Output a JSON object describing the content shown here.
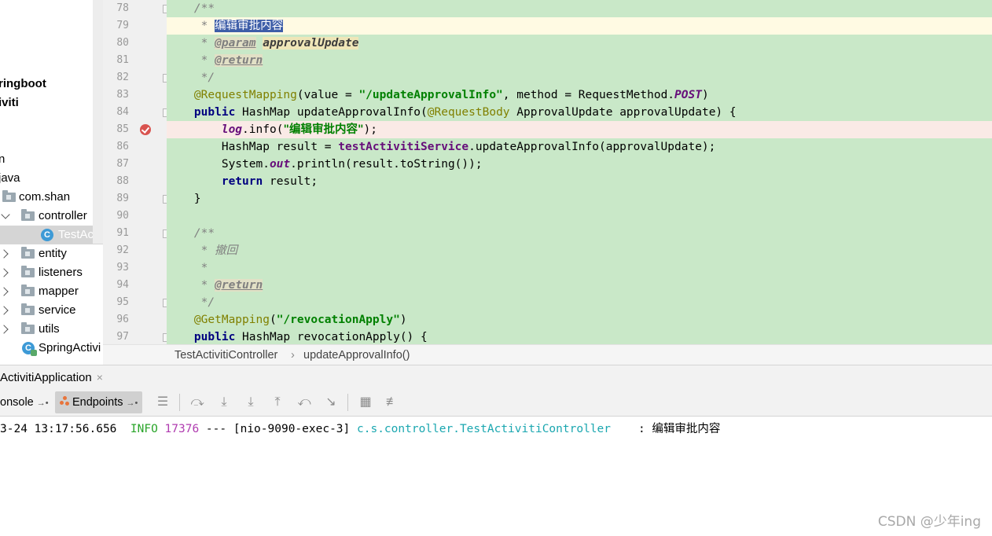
{
  "tree": {
    "items": [
      {
        "label": "ringboot",
        "bold": true
      },
      {
        "label": "iviti",
        "bold": true
      },
      {
        "label": "n"
      },
      {
        "label": "java"
      },
      {
        "label": "com.shan"
      },
      {
        "label": "controller"
      },
      {
        "label": "TestActivi"
      },
      {
        "label": "entity"
      },
      {
        "label": "listeners"
      },
      {
        "label": "mapper"
      },
      {
        "label": "service"
      },
      {
        "label": "utils"
      },
      {
        "label": "SpringActivi"
      }
    ]
  },
  "editor": {
    "line_numbers": [
      "78",
      "79",
      "80",
      "81",
      "82",
      "83",
      "84",
      "85",
      "86",
      "87",
      "88",
      "89",
      "90",
      "91",
      "92",
      "93",
      "94",
      "95",
      "96",
      "97"
    ],
    "strings": {
      "javadoc_open": "/**",
      "star": "*",
      "javadoc_close": "*/",
      "comment_edit": "编辑审批内容",
      "param_tag": "@param",
      "param_name": "approvalUpdate",
      "return_tag": "@return",
      "anno_request_mapping": "@RequestMapping",
      "value_part": "(value = ",
      "path_update": "\"/updateApprovalInfo\"",
      "method_part": ", method = RequestMethod.",
      "post": "POST",
      "close_paren": ")",
      "public": "public",
      "hashmap": " HashMap ",
      "update_sig": "updateApprovalInfo(",
      "request_body": "@RequestBody",
      "update_sig_rest": " ApprovalUpdate approvalUpdate) {",
      "log": "log",
      "info_call": ".info(",
      "log_text": "\"编辑审批内容\"",
      "end_stmt": ");",
      "hashmap_result": "HashMap result = ",
      "service_field": "testActivitiService",
      "service_call": ".updateApprovalInfo(approvalUpdate);",
      "system": "System.",
      "out": "out",
      "println": ".println(result.toString());",
      "return": "return",
      "return_rest": " result;",
      "close_brace": "}",
      "comment_revoke": "撤回",
      "anno_get_mapping": "@GetMapping",
      "open_paren": "(",
      "path_revoke": "\"/revocationApply\"",
      "revoke_sig": " HashMap revocationApply() {"
    }
  },
  "breadcrumb": {
    "class_name": "TestActivitiController",
    "separator": "›",
    "method_name": "updateApprovalInfo()"
  },
  "run_panel": {
    "tab_label": "ActivitiApplication",
    "close_glyph": "×",
    "console_tab": "onsole",
    "endpoints_tab": "Endpoints",
    "pin_glyph": "→•"
  },
  "console": {
    "timestamp": "3-24 13:17:56.656",
    "level": "INFO",
    "pid": "17376",
    "dashes": "---",
    "thread": "[nio-9090-exec-3]",
    "logger": "c.s.controller.TestActivitiController",
    "colon": ":",
    "message": "编辑审批内容"
  },
  "watermark": "CSDN @少年ing",
  "colors": {
    "changed_line_bg": "#c9e8c8",
    "caret_line_bg": "#fffae3",
    "breakpoint_line_bg": "#faeae6",
    "keyword": "#000080",
    "string": "#008000",
    "annotation": "#808000",
    "comment": "#808080",
    "field": "#660e7a",
    "selection": "#3e5ea8"
  }
}
